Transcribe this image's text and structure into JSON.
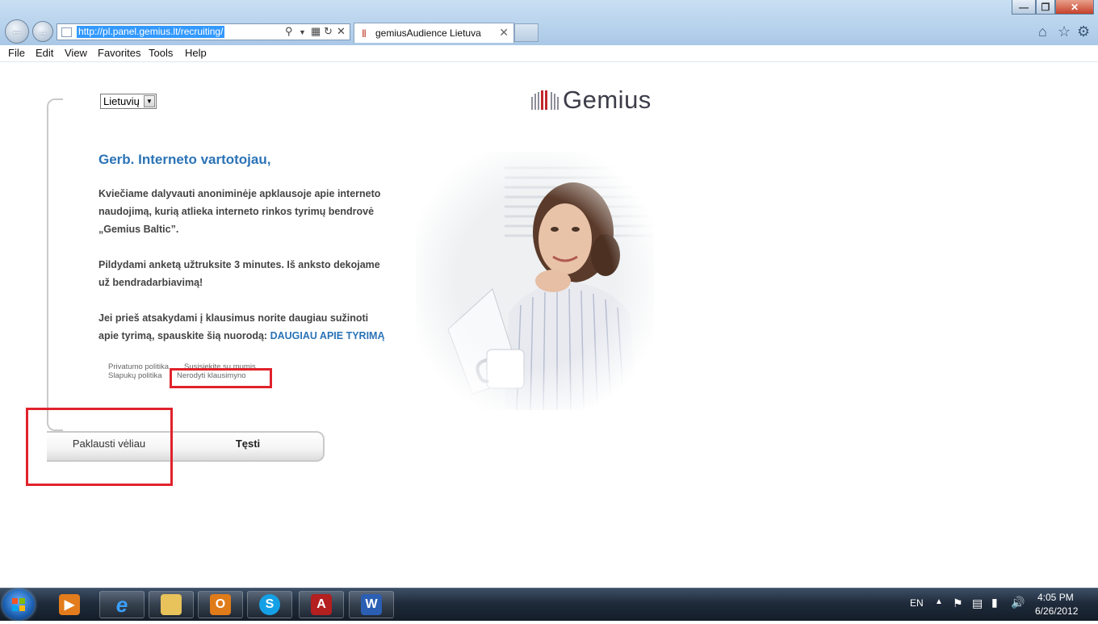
{
  "browser": {
    "url": "http://pl.panel.gemius.lt/recruiting/",
    "tab_title": "gemiusAudience Lietuva",
    "menu": [
      "File",
      "Edit",
      "View",
      "Favorites",
      "Tools",
      "Help"
    ]
  },
  "page": {
    "language_selected": "Lietuvių",
    "logo_text": "Gemius",
    "heading": "Gerb. Interneto vartotojau,",
    "para1": "Kviečiame dalyvauti anoniminėje apklausoje apie interneto naudojimą, kurią atlieka interneto rinkos tyrimų bendrovė „Gemius Baltic”.",
    "para2": "Pildydami anketą užtruksite 3 minutes. Iš anksto dekojame už bendradarbiavimą!",
    "para3_text": "Jei prieš atsakydami į klausimus norite daugiau sužinoti apie tyrimą, spauskite šią nuorodą: ",
    "para3_link": "DAUGIAU APIE TYRIMĄ",
    "links": {
      "privacy": "Privatumo politika",
      "contact": "Susisiekite su mumis",
      "cookies": "Slapukų politika",
      "dont_show": "Nerodyti klausimyno"
    },
    "buttons": {
      "later": "Paklausti vėliau",
      "continue": "Tęsti"
    }
  },
  "taskbar": {
    "language": "EN",
    "time": "4:05 PM",
    "date": "6/26/2012"
  }
}
